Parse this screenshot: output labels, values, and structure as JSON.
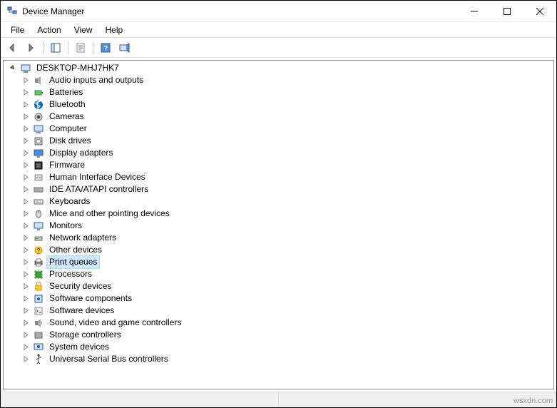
{
  "window": {
    "title": "Device Manager"
  },
  "menubar": {
    "file": "File",
    "action": "Action",
    "view": "View",
    "help": "Help"
  },
  "tree": {
    "root": "DESKTOP-MHJ7HK7",
    "categories": [
      {
        "label": "Audio inputs and outputs",
        "icon": "audio"
      },
      {
        "label": "Batteries",
        "icon": "battery"
      },
      {
        "label": "Bluetooth",
        "icon": "bluetooth"
      },
      {
        "label": "Cameras",
        "icon": "camera"
      },
      {
        "label": "Computer",
        "icon": "computer"
      },
      {
        "label": "Disk drives",
        "icon": "disk"
      },
      {
        "label": "Display adapters",
        "icon": "display"
      },
      {
        "label": "Firmware",
        "icon": "firmware"
      },
      {
        "label": "Human Interface Devices",
        "icon": "hid"
      },
      {
        "label": "IDE ATA/ATAPI controllers",
        "icon": "ide"
      },
      {
        "label": "Keyboards",
        "icon": "keyboard"
      },
      {
        "label": "Mice and other pointing devices",
        "icon": "mouse"
      },
      {
        "label": "Monitors",
        "icon": "monitor"
      },
      {
        "label": "Network adapters",
        "icon": "network"
      },
      {
        "label": "Other devices",
        "icon": "other"
      },
      {
        "label": "Print queues",
        "icon": "printer",
        "selected": true
      },
      {
        "label": "Processors",
        "icon": "cpu"
      },
      {
        "label": "Security devices",
        "icon": "security"
      },
      {
        "label": "Software components",
        "icon": "softcomp"
      },
      {
        "label": "Software devices",
        "icon": "softdev"
      },
      {
        "label": "Sound, video and game controllers",
        "icon": "sound"
      },
      {
        "label": "Storage controllers",
        "icon": "storage"
      },
      {
        "label": "System devices",
        "icon": "system"
      },
      {
        "label": "Universal Serial Bus controllers",
        "icon": "usb"
      }
    ]
  },
  "watermark": "wsxdn.com"
}
